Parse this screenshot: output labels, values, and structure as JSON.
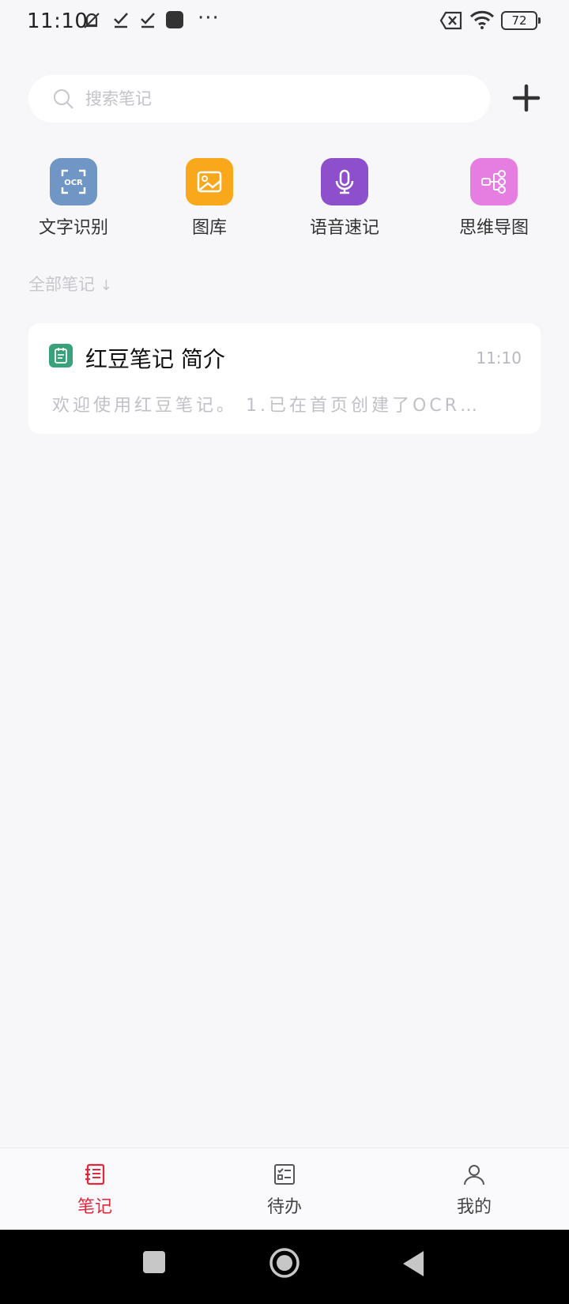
{
  "status_bar": {
    "time": "11:10",
    "overflow": "···",
    "battery": "72",
    "icons": [
      "mute-icon",
      "check-icon",
      "check-icon",
      "square-icon",
      "sim-x-icon",
      "wifi-icon",
      "battery-icon"
    ]
  },
  "search": {
    "placeholder": "搜索笔记",
    "value": ""
  },
  "tools": [
    {
      "label": "文字识别",
      "icon": "ocr-icon",
      "color": "#6f96c4"
    },
    {
      "label": "图库",
      "icon": "gallery-icon",
      "color": "#f9a81b"
    },
    {
      "label": "语音速记",
      "icon": "microphone-icon",
      "color": "#8e4fcd"
    },
    {
      "label": "思维导图",
      "icon": "mindmap-icon",
      "color": "#e57ee0"
    }
  ],
  "section": {
    "title": "全部笔记",
    "sort_glyph": "↓"
  },
  "notes": [
    {
      "title": "红豆笔记 简介",
      "time": "11:10",
      "preview": "欢迎使用红豆笔记。  1.已在首页创建了OCR…"
    }
  ],
  "bottom_nav": {
    "items": [
      {
        "label": "笔记",
        "icon": "notebook-icon",
        "active": true
      },
      {
        "label": "待办",
        "icon": "checklist-icon",
        "active": false
      },
      {
        "label": "我的",
        "icon": "profile-icon",
        "active": false
      }
    ],
    "active_color": "#e0283c"
  }
}
